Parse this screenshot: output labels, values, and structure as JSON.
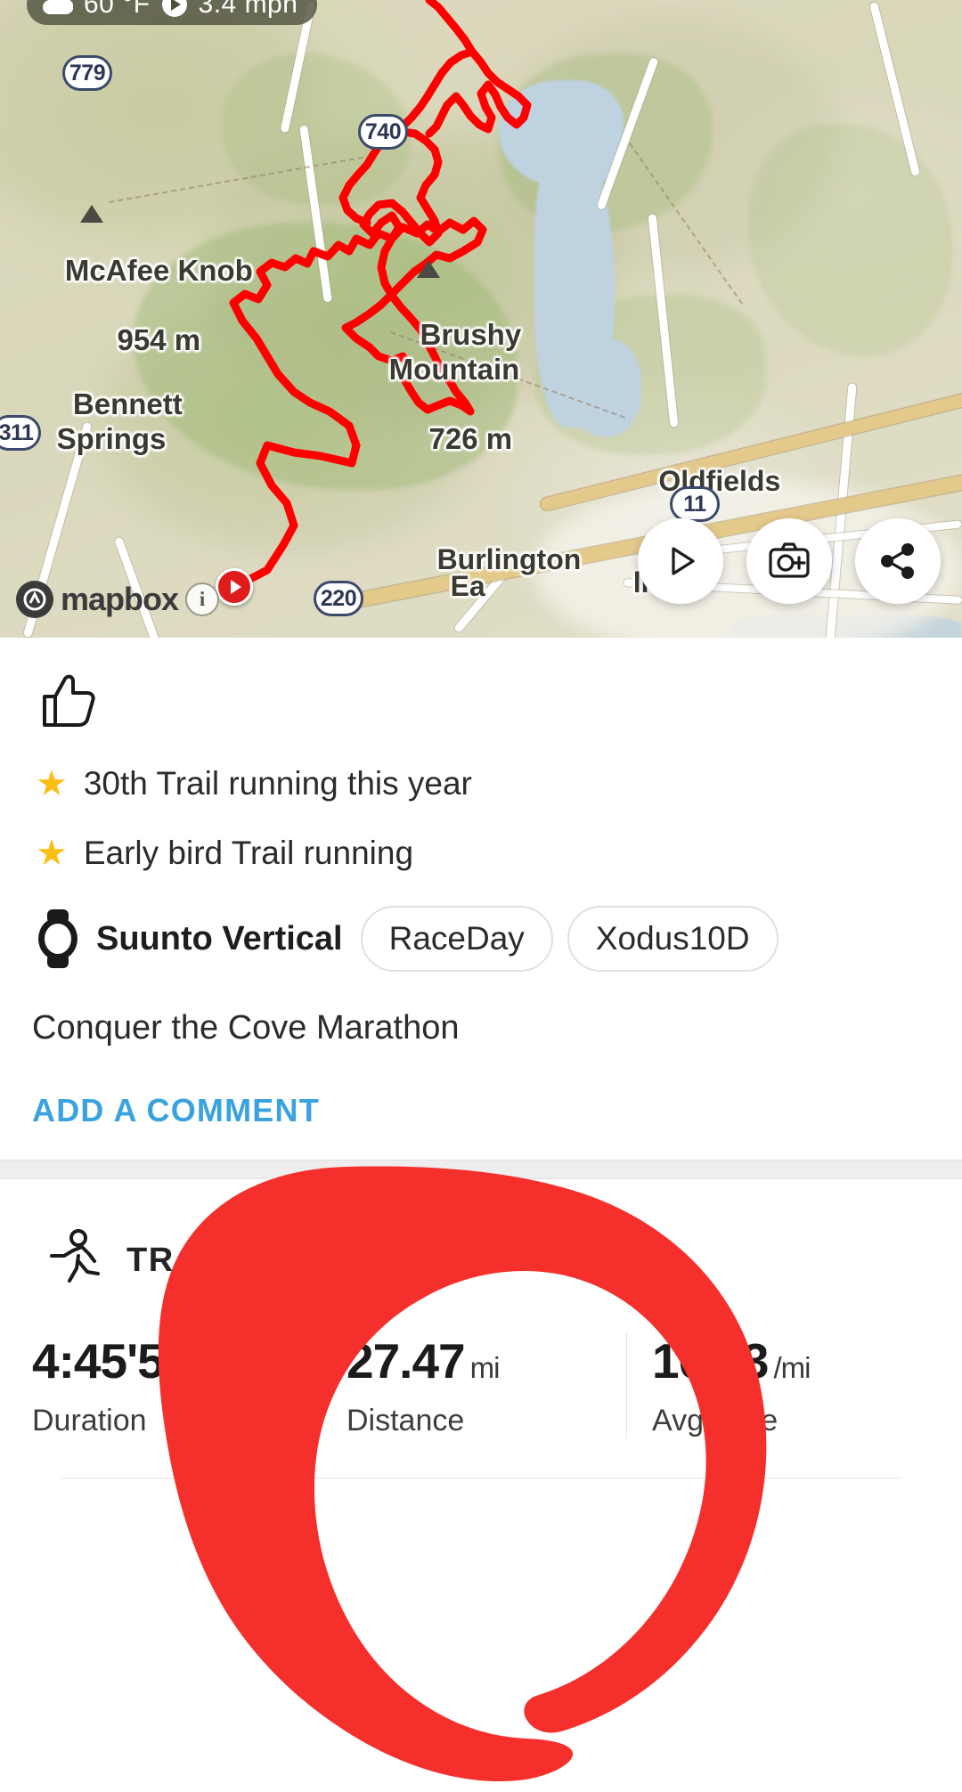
{
  "map": {
    "status_chip": {
      "weather_icon": "cloud-icon",
      "temperature": "60 °F",
      "speed_icon": "speed-gauge-icon",
      "speed": "3.4 mph"
    },
    "labels": [
      {
        "name": "mcafee-knob",
        "title": "McAfee Knob",
        "elevation": "954 m"
      },
      {
        "name": "brushy-mountain",
        "title": "Brushy\nMountain",
        "elevation": "726 m"
      },
      {
        "name": "bennett-springs",
        "title": "Bennett\nSprings",
        "elevation": ""
      },
      {
        "name": "oldfields",
        "title": "Oldfields",
        "elevation": ""
      },
      {
        "name": "burlington",
        "title": "Burlington",
        "elevation": ""
      },
      {
        "name": "burlington-east",
        "title": "Ea",
        "elevation": ""
      },
      {
        "name": "collins",
        "title": "llins",
        "elevation": ""
      }
    ],
    "road_shields": [
      "779",
      "740",
      "311",
      "220",
      "11"
    ],
    "attribution": {
      "logo_text": "mapbox",
      "info_glyph": "i"
    },
    "actions": [
      {
        "name": "play-route-button",
        "icon": "play-icon"
      },
      {
        "name": "photo-button",
        "icon": "camera-plus-icon"
      },
      {
        "name": "share-button",
        "icon": "share-icon"
      }
    ],
    "track_color": "#FF0000",
    "start_marker": "start-play-marker"
  },
  "social": {
    "kudos_icon": "thumbs-up-icon"
  },
  "achievements": [
    {
      "icon": "star-icon",
      "text": "30th Trail running this year"
    },
    {
      "icon": "star-icon",
      "text": "Early bird Trail running"
    }
  ],
  "gear": {
    "device_icon": "watch-icon",
    "device_name": "Suunto Vertical",
    "tags": [
      "RaceDay",
      "Xodus10D"
    ]
  },
  "description": "Conquer the Cove Marathon",
  "comment_link": "ADD A COMMENT",
  "activity": {
    "sport_icon": "running-icon",
    "sport_label": "TRAIL RUNNING",
    "stats": [
      {
        "name": "duration",
        "value": "4:45'54",
        "unit": "",
        "label": "Duration"
      },
      {
        "name": "distance",
        "value": "27.47",
        "unit": "mi",
        "label": "Distance"
      },
      {
        "name": "avg-pace",
        "value": "10'23",
        "unit": "/mi",
        "label": "Avg pace"
      }
    ]
  },
  "colors": {
    "accent_blue": "#3AA3DE",
    "star_gold": "#FBBF14",
    "track_red": "#FF0000",
    "annotation_red": "#F5302C"
  }
}
